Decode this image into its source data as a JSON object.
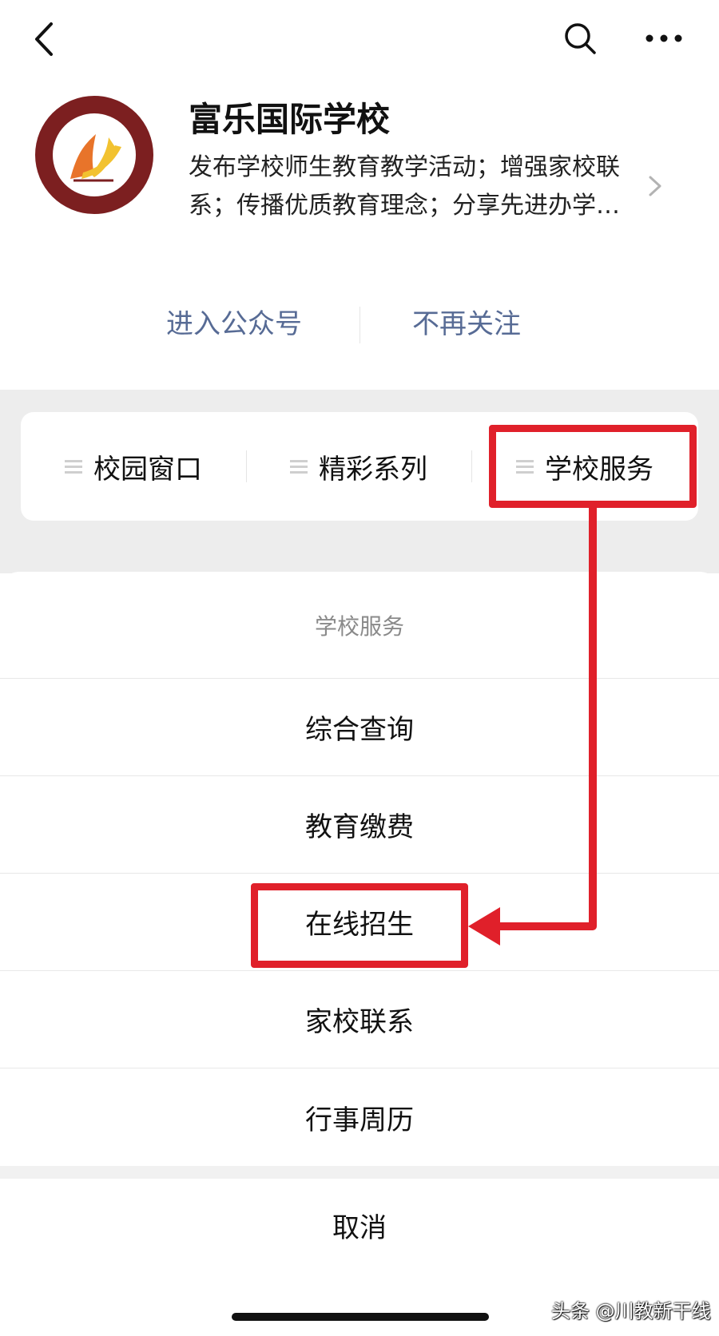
{
  "header": {
    "title": "富乐国际学校",
    "description_line1": "发布学校师生教育教学活动；增强家校联",
    "description_line2": "系；传播优质教育理念；分享先进办学…"
  },
  "actions": {
    "enter": "进入公众号",
    "unfollow": "不再关注"
  },
  "menu": {
    "tabs": [
      {
        "label": "校园窗口"
      },
      {
        "label": "精彩系列"
      },
      {
        "label": "学校服务"
      }
    ]
  },
  "sheet": {
    "title": "学校服务",
    "items": [
      {
        "label": "综合查询"
      },
      {
        "label": "教育缴费"
      },
      {
        "label": "在线招生"
      },
      {
        "label": "家校联系"
      },
      {
        "label": "行事周历"
      }
    ],
    "cancel": "取消"
  },
  "watermark": "头条 @川教新干线",
  "colors": {
    "link": "#576b95",
    "annotation": "#e0202a",
    "logo_ring": "#7c1f20",
    "logo_orange": "#e8742a",
    "logo_yellow": "#f2c230"
  },
  "icons": [
    "back-icon",
    "search-icon",
    "more-icon",
    "chevron-right-icon",
    "lines-icon"
  ]
}
